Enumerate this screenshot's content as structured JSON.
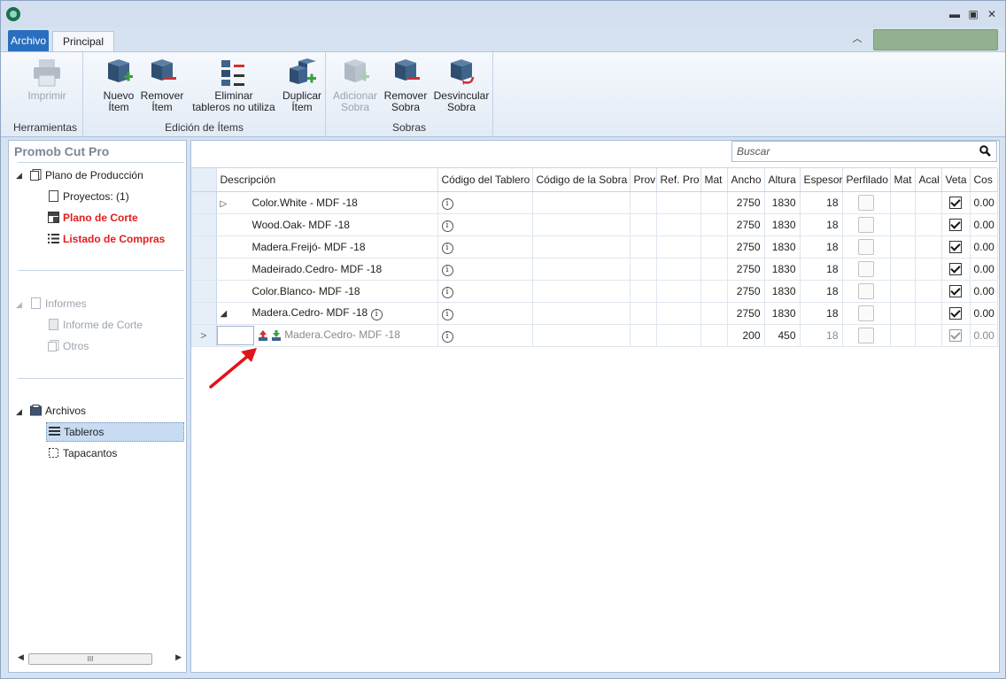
{
  "tabs": {
    "archivo": "Archivo",
    "principal": "Principal"
  },
  "ribbon": {
    "groups": [
      {
        "label": "Herramientas",
        "buttons": [
          {
            "line1": "Imprimir",
            "line2": "",
            "disabled": true
          }
        ]
      },
      {
        "label": "Edición de Ítems",
        "buttons": [
          {
            "line1": "Nuevo",
            "line2": "Ítem",
            "disabled": false
          },
          {
            "line1": "Remover",
            "line2": "Ítem",
            "disabled": false
          },
          {
            "line1": "Eliminar",
            "line2": "tableros no utiliza",
            "disabled": false
          },
          {
            "line1": "Duplicar",
            "line2": "Ítem",
            "disabled": false
          }
        ]
      },
      {
        "label": "Sobras",
        "buttons": [
          {
            "line1": "Adicionar",
            "line2": "Sobra",
            "disabled": true
          },
          {
            "line1": "Remover",
            "line2": "Sobra",
            "disabled": false
          },
          {
            "line1": "Desvincular",
            "line2": "Sobra",
            "disabled": false
          }
        ]
      }
    ]
  },
  "sidebar": {
    "title": "Promob Cut Pro",
    "plano": "Plano de Producción",
    "proyectos": "Proyectos: (1)",
    "plano_corte": "Plano de Corte",
    "listado": "Listado de Compras",
    "informes": "Informes",
    "informe_corte": "Informe de Corte",
    "otros": "Otros",
    "archivos": "Archivos",
    "tableros": "Tableros",
    "tapacantos": "Tapacantos",
    "scroll_thumb": "III"
  },
  "search": {
    "placeholder": "Buscar"
  },
  "grid": {
    "columns": [
      "Descripción",
      "Código del Tablero",
      "Código de la Sobra",
      "Prov",
      "Ref. Pro",
      "Mat",
      "Ancho",
      "Altura",
      "Espesor",
      "Perfilado",
      "Mat",
      "Acal",
      "Veta",
      "Cos"
    ],
    "rows": [
      {
        "expander": "▷",
        "desc": "Color.White - MDF -18",
        "ancho": "2750",
        "altura": "1830",
        "espesor": "18",
        "veta": true,
        "cos": "0.00"
      },
      {
        "expander": "",
        "desc": "Wood.Oak- MDF -18",
        "ancho": "2750",
        "altura": "1830",
        "espesor": "18",
        "veta": true,
        "cos": "0.00"
      },
      {
        "expander": "",
        "desc": "Madera.Freijó- MDF -18",
        "ancho": "2750",
        "altura": "1830",
        "espesor": "18",
        "veta": true,
        "cos": "0.00"
      },
      {
        "expander": "",
        "desc": "Madeirado.Cedro- MDF -18",
        "ancho": "2750",
        "altura": "1830",
        "espesor": "18",
        "veta": true,
        "cos": "0.00"
      },
      {
        "expander": "",
        "desc": "Color.Blanco- MDF -18",
        "ancho": "2750",
        "altura": "1830",
        "espesor": "18",
        "veta": true,
        "cos": "0.00"
      },
      {
        "expander": "◢",
        "desc": "Madera.Cedro- MDF -18",
        "ancho": "2750",
        "altura": "1830",
        "espesor": "18",
        "veta": true,
        "cos": "0.00"
      }
    ],
    "subrow": {
      "marker": ">",
      "desc": "Madera.Cedro- MDF -18",
      "ancho": "200",
      "altura": "450",
      "espesor": "18",
      "veta": true,
      "cos": "0.00"
    }
  },
  "colors": {
    "accent": "#2a6fbf",
    "red_link": "#e31d1d",
    "annotation_arrow": "#e0141a"
  }
}
